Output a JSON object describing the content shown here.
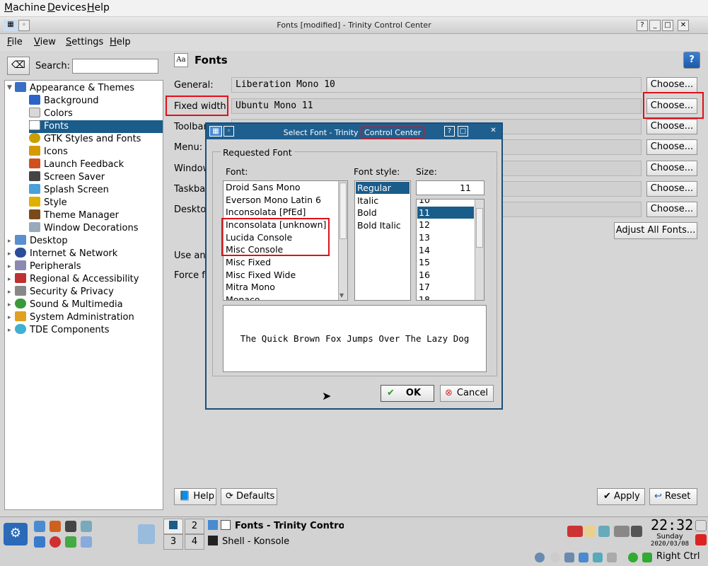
{
  "vm_menu": [
    "Machine",
    "Devices",
    "Help"
  ],
  "window": {
    "title": "Fonts [modified] - Trinity Control Center",
    "buttons": [
      "?",
      "_",
      "□",
      "✕"
    ]
  },
  "app_menu": [
    "File",
    "View",
    "Settings",
    "Help"
  ],
  "search": {
    "label": "Search:",
    "value": ""
  },
  "tree": [
    {
      "label": "Appearance & Themes",
      "expanded": true
    },
    {
      "label": "Background"
    },
    {
      "label": "Colors"
    },
    {
      "label": "Fonts",
      "selected": true
    },
    {
      "label": "GTK Styles and Fonts"
    },
    {
      "label": "Icons"
    },
    {
      "label": "Launch Feedback"
    },
    {
      "label": "Screen Saver"
    },
    {
      "label": "Splash Screen"
    },
    {
      "label": "Style"
    },
    {
      "label": "Theme Manager"
    },
    {
      "label": "Window Decorations"
    },
    {
      "label": "Desktop"
    },
    {
      "label": "Internet & Network"
    },
    {
      "label": "Peripherals"
    },
    {
      "label": "Regional & Accessibility"
    },
    {
      "label": "Security & Privacy"
    },
    {
      "label": "Sound & Multimedia"
    },
    {
      "label": "System Administration"
    },
    {
      "label": "TDE Components"
    }
  ],
  "panel": {
    "title": "Fonts",
    "rows": [
      {
        "label": "General:",
        "value": "Liberation Mono 10"
      },
      {
        "label": "Fixed width:",
        "value": "Ubuntu Mono 11"
      },
      {
        "label": "Toolbar:",
        "value": ""
      },
      {
        "label": "Menu:",
        "value": ""
      },
      {
        "label": "Window title:",
        "value": ""
      },
      {
        "label": "Taskbar:",
        "value": ""
      },
      {
        "label": "Desktop:",
        "value": ""
      }
    ],
    "choose_label": "Choose...",
    "adjust_all": "Adjust All Fonts...",
    "use_anti": "Use anti-aliasing",
    "force_fonts": "Force fonts DPI",
    "help": "Help",
    "defaults": "Defaults",
    "apply": "Apply",
    "reset": "Reset"
  },
  "dialog": {
    "title_left": "Select Font - Trinity",
    "title_right": "Control Center",
    "group": "Requested Font",
    "font_label": "Font:",
    "style_label": "Font style:",
    "size_label": "Size:",
    "fonts": [
      "Droid Sans Mono",
      "Everson Mono Latin 6",
      "Inconsolata [PfEd]",
      "Inconsolata [unknown]",
      "Lucida Console",
      "Misc Console",
      "Misc Fixed",
      "Misc Fixed Wide",
      "Mitra Mono",
      "Monaco"
    ],
    "styles": [
      "Regular",
      "Italic",
      "Bold",
      "Bold Italic"
    ],
    "size_value": "11",
    "sizes": [
      "10",
      "11",
      "12",
      "13",
      "14",
      "15",
      "16",
      "17",
      "18"
    ],
    "preview": "The Quick Brown Fox Jumps Over The Lazy Dog",
    "ok": "OK",
    "cancel": "Cancel"
  },
  "taskbar": {
    "workspaces": [
      "1",
      "2",
      "3",
      "4"
    ],
    "tasks": [
      "Fonts - Trinity Control Ce",
      "Shell - Konsole"
    ],
    "clock_time": "22:32",
    "clock_day": "Sunday",
    "clock_date": "2020/03/08",
    "host_key": "Right Ctrl"
  }
}
